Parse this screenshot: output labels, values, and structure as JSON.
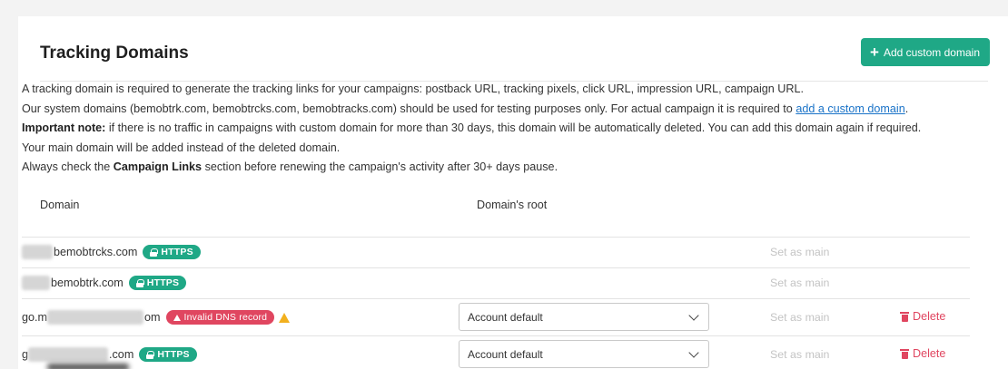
{
  "header": {
    "title": "Tracking Domains",
    "add_button_label": "Add custom domain",
    "add_button_icon": "plus-icon"
  },
  "info": {
    "line1": "A tracking domain is required to generate the tracking links for your campaigns: postback URL, tracking pixels, click URL, impression URL, campaign URL.",
    "line2_prefix": "Our system domains (bemobtrk.com, bemobtrcks.com, bemobtracks.com) should be used for testing purposes only. For actual campaign it is required to ",
    "line2_link": "add a custom domain",
    "line2_suffix": ".",
    "line3_bold": "Important note:",
    "line3_text": " if there is no traffic in campaigns with custom domain for more than 30 days, this domain will be automatically deleted. You can add this domain again if required.",
    "line4": "Your main domain will be added instead of the deleted domain.",
    "line5_prefix": "Always check the ",
    "line5_bold": "Campaign Links",
    "line5_suffix": " section before renewing the campaign's activity after 30+ days pause."
  },
  "table": {
    "columns": [
      "Domain",
      "Domain's root"
    ],
    "rows": [
      {
        "domain_prefix": "",
        "domain_suffix": "bemobtrcks.com",
        "badge": "HTTPS",
        "badge_type": "https",
        "root": "",
        "set_main": "Set as main",
        "delete": ""
      },
      {
        "domain_prefix": "",
        "domain_suffix": "bemobtrk.com",
        "badge": "HTTPS",
        "badge_type": "https",
        "root": "",
        "set_main": "Set as main",
        "delete": ""
      },
      {
        "domain_prefix": "go.m",
        "domain_suffix": "om",
        "badge": "Invalid DNS record",
        "badge_type": "invalid",
        "root": "Account default",
        "set_main": "Set as main",
        "delete": "Delete"
      },
      {
        "domain_prefix": "g",
        "domain_suffix": ".com",
        "badge": "HTTPS",
        "badge_type": "https",
        "root": "Account default",
        "set_main": "Set as main",
        "delete": "Delete"
      }
    ]
  },
  "colors": {
    "accent": "#1fa886",
    "danger": "#e04660",
    "warning": "#f2b01e",
    "link": "#1a73c8"
  }
}
